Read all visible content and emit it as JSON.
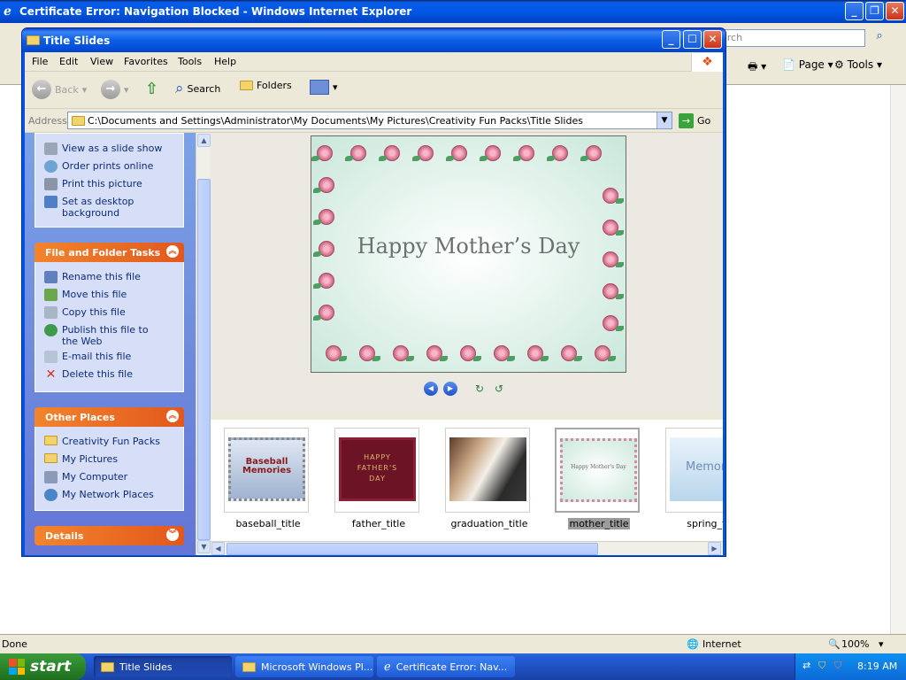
{
  "ie": {
    "title": "Certificate Error: Navigation Blocked - Windows Internet Explorer",
    "search_placeholder": "arch",
    "commands": {
      "page": "Page",
      "tools": "Tools"
    },
    "status": {
      "left": "Done",
      "zone": "Internet",
      "zoom": "100%"
    }
  },
  "explorer": {
    "title": "Title Slides",
    "menu": [
      "File",
      "Edit",
      "View",
      "Favorites",
      "Tools",
      "Help"
    ],
    "toolbar": {
      "back": "Back",
      "search": "Search",
      "folders": "Folders"
    },
    "address": {
      "label": "Address",
      "path": "C:\\Documents and Settings\\Administrator\\My Documents\\My Pictures\\Creativity Fun Packs\\Title Slides",
      "go": "Go"
    },
    "picture_tasks": [
      "View as a slide show",
      "Order prints online",
      "Print this picture",
      "Set as desktop background"
    ],
    "file_tasks": {
      "title": "File and Folder Tasks",
      "items": [
        "Rename this file",
        "Move this file",
        "Copy this file",
        "Publish this file to the Web",
        "E-mail this file",
        "Delete this file"
      ]
    },
    "other_places": {
      "title": "Other Places",
      "items": [
        "Creativity Fun Packs",
        "My Pictures",
        "My Computer",
        "My Network Places"
      ]
    },
    "details": {
      "title": "Details"
    },
    "preview": {
      "message": "Happy Mother’s Day"
    },
    "thumbnails": [
      {
        "name": "baseball_title",
        "text": "Baseball Memories"
      },
      {
        "name": "father_title",
        "text": "HAPPY FATHER'S DAY"
      },
      {
        "name": "graduation_title",
        "text": ""
      },
      {
        "name": "mother_title",
        "text": "Happy Mother's Day",
        "selected": true
      },
      {
        "name": "spring_tit",
        "text": "Memorie"
      }
    ]
  },
  "taskbar": {
    "start": "start",
    "buttons": [
      "Title Slides",
      "Microsoft Windows Pl...",
      "Certificate Error: Nav..."
    ],
    "clock": "8:19 AM"
  }
}
